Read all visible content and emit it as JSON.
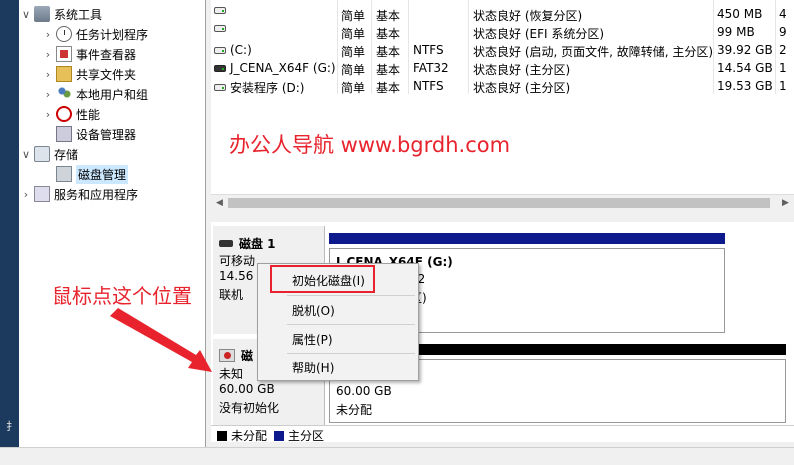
{
  "tree": {
    "items": [
      {
        "label": "系统工具",
        "expander": "∨",
        "icon": "tools-icon"
      },
      {
        "label": "任务计划程序",
        "expander": "›",
        "icon": "clock-icon"
      },
      {
        "label": "事件查看器",
        "expander": "›",
        "icon": "event-viewer-icon"
      },
      {
        "label": "共享文件夹",
        "expander": "›",
        "icon": "shared-folder-icon"
      },
      {
        "label": "本地用户和组",
        "expander": "›",
        "icon": "users-icon"
      },
      {
        "label": "性能",
        "expander": "›",
        "icon": "performance-icon"
      },
      {
        "label": "设备管理器",
        "expander": "",
        "icon": "device-manager-icon"
      },
      {
        "label": "存储",
        "expander": "∨",
        "icon": "storage-icon"
      },
      {
        "label": "磁盘管理",
        "expander": "",
        "icon": "disk-management-icon"
      },
      {
        "label": "服务和应用程序",
        "expander": "›",
        "icon": "services-icon"
      }
    ]
  },
  "volumes": [
    {
      "name": "",
      "layout": "简单",
      "type": "基本",
      "fs": "",
      "status": "状态良好 (恢复分区)",
      "capacity": "450 MB",
      "free": "4"
    },
    {
      "name": "",
      "layout": "简单",
      "type": "基本",
      "fs": "",
      "status": "状态良好 (EFI 系统分区)",
      "capacity": "99 MB",
      "free": "9"
    },
    {
      "name": "(C:)",
      "layout": "简单",
      "type": "基本",
      "fs": "NTFS",
      "status": "状态良好 (启动, 页面文件, 故障转储, 主分区)",
      "capacity": "39.92 GB",
      "free": "2"
    },
    {
      "name": "J_CENA_X64F (G:)",
      "layout": "简单",
      "type": "基本",
      "fs": "FAT32",
      "status": "状态良好 (主分区)",
      "capacity": "14.54 GB",
      "free": "1"
    },
    {
      "name": "安装程序 (D:)",
      "layout": "简单",
      "type": "基本",
      "fs": "NTFS",
      "status": "状态良好 (主分区)",
      "capacity": "19.53 GB",
      "free": "1"
    }
  ],
  "watermark": "办公人导航   www.bgrdh.com",
  "annotation": "鼠标点这个位置",
  "disk1": {
    "title": "磁盘 1",
    "type": "可移动",
    "size": "14.56",
    "status": "联机",
    "partition_name": "J_CENA_X64F  (G:)",
    "partition_line2": "32",
    "partition_line3": "区)"
  },
  "disk2": {
    "title": "磁",
    "type": "未知",
    "size": "60.00 GB",
    "status": "没有初始化",
    "partition_size": "60.00 GB",
    "partition_status": "未分配"
  },
  "context_menu": {
    "items": [
      "初始化磁盘(I)",
      "脱机(O)",
      "属性(P)",
      "帮助(H)"
    ]
  },
  "legend": {
    "unallocated": "未分配",
    "primary": "主分区"
  },
  "left_strip_glyph": "扌",
  "colors": {
    "annotation_red": "#e8232d",
    "primary_partition": "#0c1a8c",
    "unallocated": "#000000",
    "selection": "#cce8ff"
  }
}
